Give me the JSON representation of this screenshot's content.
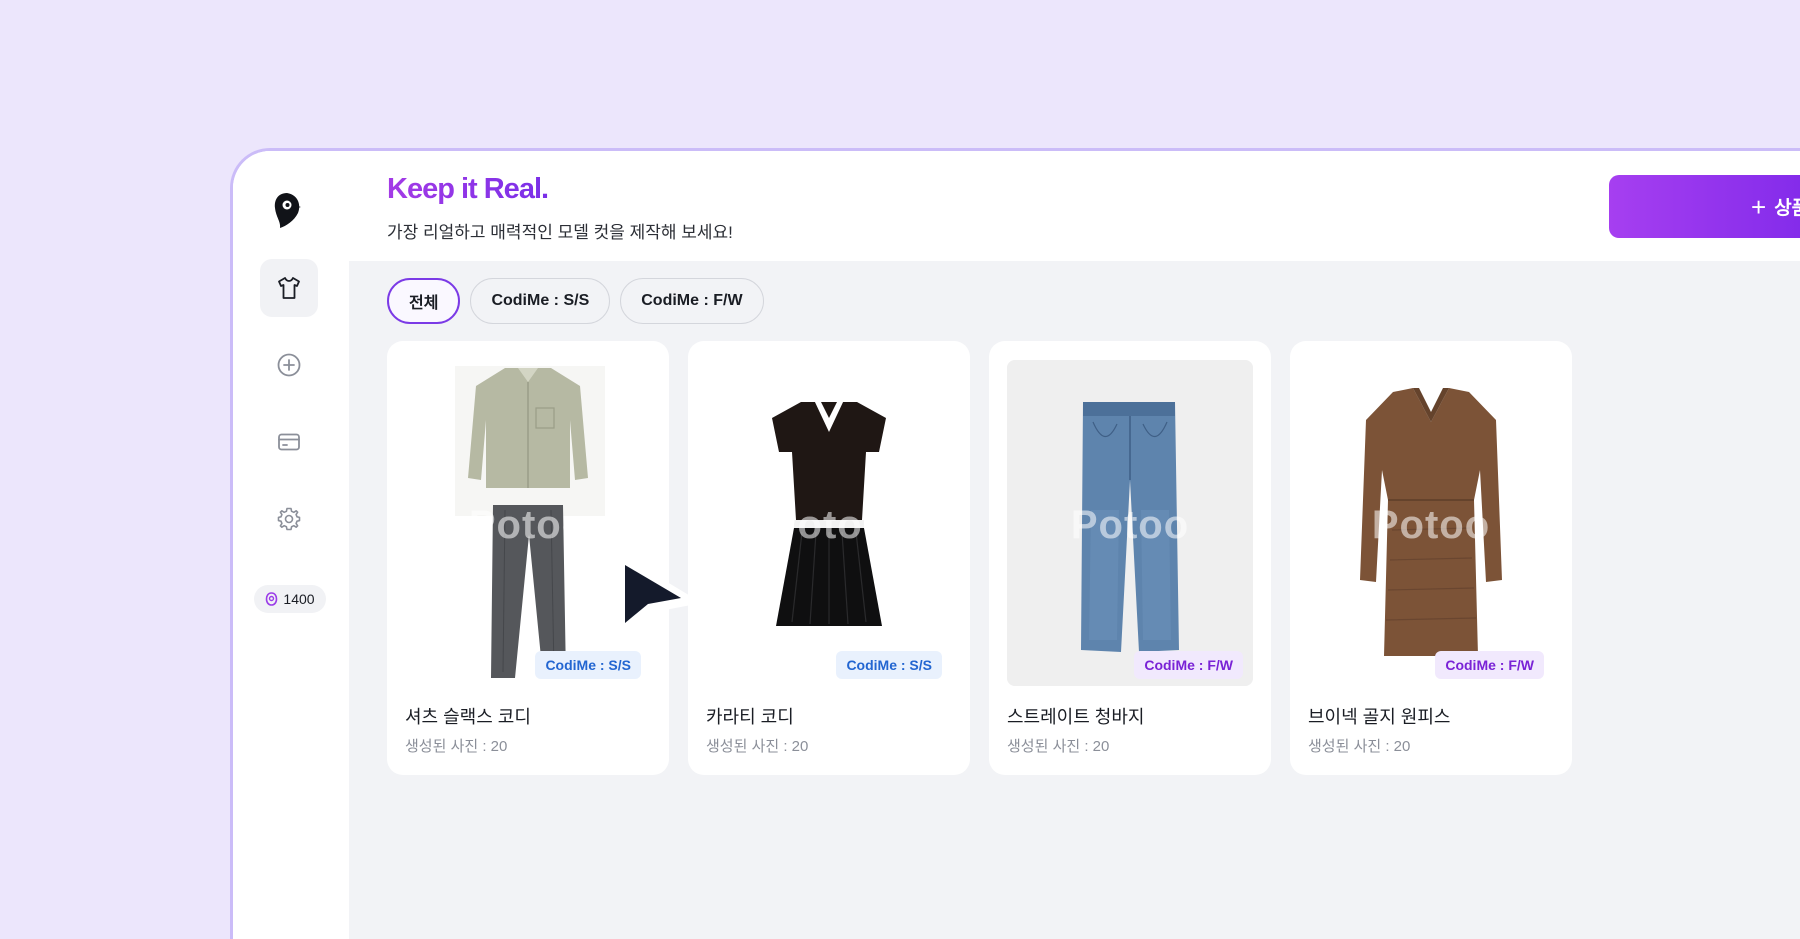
{
  "brand": {
    "title": "Keep it Real.",
    "subtitle": "가장 리얼하고 매력적인 모델 컷을 제작해 보세요!"
  },
  "header": {
    "add_button_label": "상품 추가",
    "add_button_icon": "plus-icon"
  },
  "sidebar": {
    "items": [
      {
        "icon": "shirt-icon",
        "active": true
      },
      {
        "icon": "plus-circle-icon",
        "active": false
      },
      {
        "icon": "card-icon",
        "active": false
      },
      {
        "icon": "gear-icon",
        "active": false
      }
    ],
    "credits": "1400"
  },
  "tabs": [
    {
      "label": "전체",
      "active": true
    },
    {
      "label": "CodiMe : S/S",
      "active": false
    },
    {
      "label": "CodiMe : F/W",
      "active": false
    }
  ],
  "products": [
    {
      "title": "셔츠 슬랙스 코디",
      "meta": "생성된 사진 : 20",
      "badge": "CodiMe : S/S",
      "watermark": "Potoo"
    },
    {
      "title": "카라티 코디",
      "meta": "생성된 사진 : 20",
      "badge": "CodiMe : S/S",
      "watermark": "Potoo"
    },
    {
      "title": "스트레이트 청바지",
      "meta": "생성된 사진 : 20",
      "badge": "CodiMe : F/W",
      "watermark": "Potoo"
    },
    {
      "title": "브이넥 골지 원피스",
      "meta": "생성된 사진 : 20",
      "badge": "CodiMe : F/W",
      "watermark": "Potoo"
    }
  ],
  "colors": {
    "background": "#ece6fc",
    "accent": "#7a2fe8",
    "badge_ss": "#2366d1",
    "badge_fw": "#7a23d6"
  }
}
